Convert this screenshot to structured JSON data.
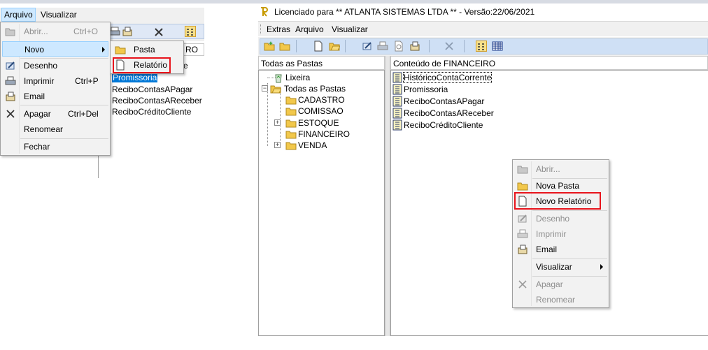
{
  "left_app": {
    "menubar": {
      "arquivo": "Arquivo",
      "visualizar": "Visualizar"
    },
    "header_fragment": "RO",
    "list_fragment_e": "e",
    "list_items": [
      "Promissoria",
      "ReciboContasAPagar",
      "ReciboContasAReceber",
      "ReciboCréditoCliente"
    ],
    "arquivo_menu": {
      "abrir": {
        "label": "Abrir...",
        "shortcut": "Ctrl+O"
      },
      "novo": {
        "label": "Novo"
      },
      "desenho": {
        "label": "Desenho"
      },
      "imprimir": {
        "label": "Imprimir",
        "shortcut": "Ctrl+P"
      },
      "email": {
        "label": "Email"
      },
      "apagar": {
        "label": "Apagar",
        "shortcut": "Ctrl+Del"
      },
      "renomear": {
        "label": "Renomear"
      },
      "fechar": {
        "label": "Fechar"
      }
    },
    "novo_submenu": {
      "pasta": "Pasta",
      "relatorio": "Relatório"
    }
  },
  "right_app": {
    "title": "Licenciado para ** ATLANTA SISTEMAS LTDA ** - Versão:22/06/2021",
    "menubar": {
      "extras": "Extras",
      "arquivo": "Arquivo",
      "visualizar": "Visualizar"
    },
    "folders_header": "Todas as Pastas",
    "content_header": "Conteúdo de FINANCEIRO",
    "tree": {
      "lixeira": "Lixeira",
      "todas": "Todas as Pastas",
      "children": [
        "CADASTRO",
        "COMISSAO",
        "ESTOQUE",
        "FINANCEIRO",
        "VENDA"
      ]
    },
    "reports": [
      "HistóricoContaCorrente",
      "Promissoria",
      "ReciboContasAPagar",
      "ReciboContasAReceber",
      "ReciboCréditoCliente"
    ],
    "context_menu": {
      "abrir": "Abrir...",
      "nova_pasta": "Nova Pasta",
      "novo_relatorio": "Novo Relatório",
      "desenho": "Desenho",
      "imprimir": "Imprimir",
      "email": "Email",
      "visualizar": "Visualizar",
      "apagar": "Apagar",
      "renomear": "Renomear"
    }
  },
  "colors": {
    "highlight_border": "#e8141c",
    "menu_hover": "#cde8ff",
    "selection": "#0078d7"
  }
}
